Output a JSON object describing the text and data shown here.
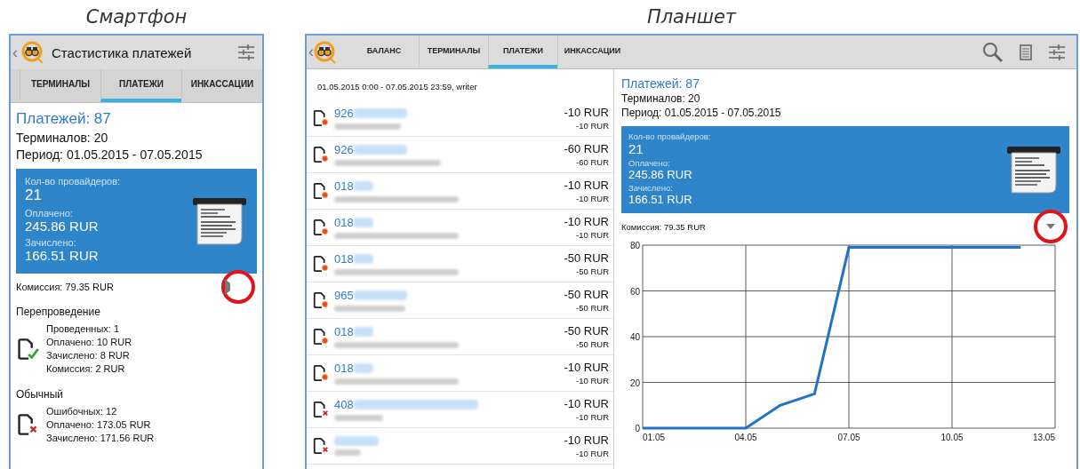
{
  "smartphone": {
    "caption": "Смартфон",
    "header": {
      "back": "‹",
      "title": "Стастистика платежей"
    },
    "tabs": [
      {
        "label": "ТЕРМИНАЛЫ",
        "selected": false
      },
      {
        "label": "ПЛАТЕЖИ",
        "selected": true
      },
      {
        "label": "ИНКАССАЦИИ",
        "selected": false
      }
    ],
    "summary": {
      "payments": "Платежей: 87",
      "terminals": "Терминалов: 20",
      "period": "Период: 01.05.2015 - 07.05.2015"
    },
    "card": [
      {
        "label": "Кол-во провайдеров:",
        "value": "21"
      },
      {
        "label": "Оплачено:",
        "value": "245.86 RUR"
      },
      {
        "label": "Зачислено:",
        "value": "166.51 RUR"
      }
    ],
    "commission": "Комиссия: 79.35 RUR",
    "groups": [
      {
        "title": "Перепроведение",
        "kind": "success",
        "lines": [
          "Проведенных: 1",
          "Оплачено: 10 RUR",
          "Зачислено: 8 RUR",
          "Комиссия: 2 RUR"
        ]
      },
      {
        "title": "Обычный",
        "kind": "error",
        "lines": [
          "Ошибочных: 12",
          "Оплачено: 173.05 RUR",
          "Зачислено: 171.56 RUR"
        ]
      }
    ]
  },
  "tablet": {
    "caption": "Планшет",
    "header": {
      "back": "‹"
    },
    "tabs": [
      {
        "label": "БАЛАНС",
        "selected": false
      },
      {
        "label": "ТЕРМИНАЛЫ",
        "selected": false
      },
      {
        "label": "ПЛАТЕЖИ",
        "selected": true
      },
      {
        "label": "ИНКАССАЦИИ",
        "selected": false
      }
    ],
    "filter": "01.05.2015 0:00 - 07.05.2015 23:59,  writer",
    "rows": [
      {
        "number": "926",
        "kind": "pending",
        "amount": "-10 RUR",
        "sub_amount": "-10 RUR"
      },
      {
        "number": "926",
        "kind": "pending",
        "amount": "-60 RUR",
        "sub_amount": "-60 RUR"
      },
      {
        "number": "018",
        "kind": "pending",
        "amount": "-10 RUR",
        "sub_amount": "-10 RUR"
      },
      {
        "number": "018",
        "kind": "pending",
        "amount": "-10 RUR",
        "sub_amount": "-10 RUR"
      },
      {
        "number": "018",
        "kind": "pending",
        "amount": "-50 RUR",
        "sub_amount": "-50 RUR"
      },
      {
        "number": "965",
        "kind": "pending",
        "amount": "-50 RUR",
        "sub_amount": "-50 RUR"
      },
      {
        "number": "018",
        "kind": "pending",
        "amount": "-50 RUR",
        "sub_amount": "-50 RUR"
      },
      {
        "number": "018",
        "kind": "pending",
        "amount": "-10 RUR",
        "sub_amount": "-10 RUR"
      },
      {
        "number": "408",
        "kind": "error",
        "amount": "-10 RUR",
        "sub_amount": "-10 RUR"
      },
      {
        "kind": "error",
        "amount": "-10 RUR",
        "sub_amount": "-10 RUR"
      }
    ],
    "summary": {
      "payments": "Платежей: 87",
      "terminals": "Терминалов: 20",
      "period": "Период: 01.05.2015 - 07.05.2015"
    },
    "card": [
      {
        "label": "Кол-во провайдеров:",
        "value": "21"
      },
      {
        "label": "Оплачено:",
        "value": "245.86 RUR"
      },
      {
        "label": "Зачислено:",
        "value": "166.51 RUR"
      }
    ],
    "commission": "Комиссия: 79.35 RUR",
    "chart_data": {
      "type": "line",
      "categories": [
        "01.05",
        null,
        null,
        "04.05",
        null,
        null,
        "07.05",
        null,
        null,
        "10.05",
        null,
        null,
        "13.05"
      ],
      "series": [
        {
          "color": "#1e73c8",
          "values": [
            0,
            0,
            0,
            0,
            10,
            15,
            79,
            79,
            79,
            79,
            79,
            79,
            null
          ]
        }
      ],
      "ylim": [
        0,
        80
      ],
      "grid": true,
      "yticks": [
        0,
        20,
        40,
        60,
        80
      ]
    }
  }
}
